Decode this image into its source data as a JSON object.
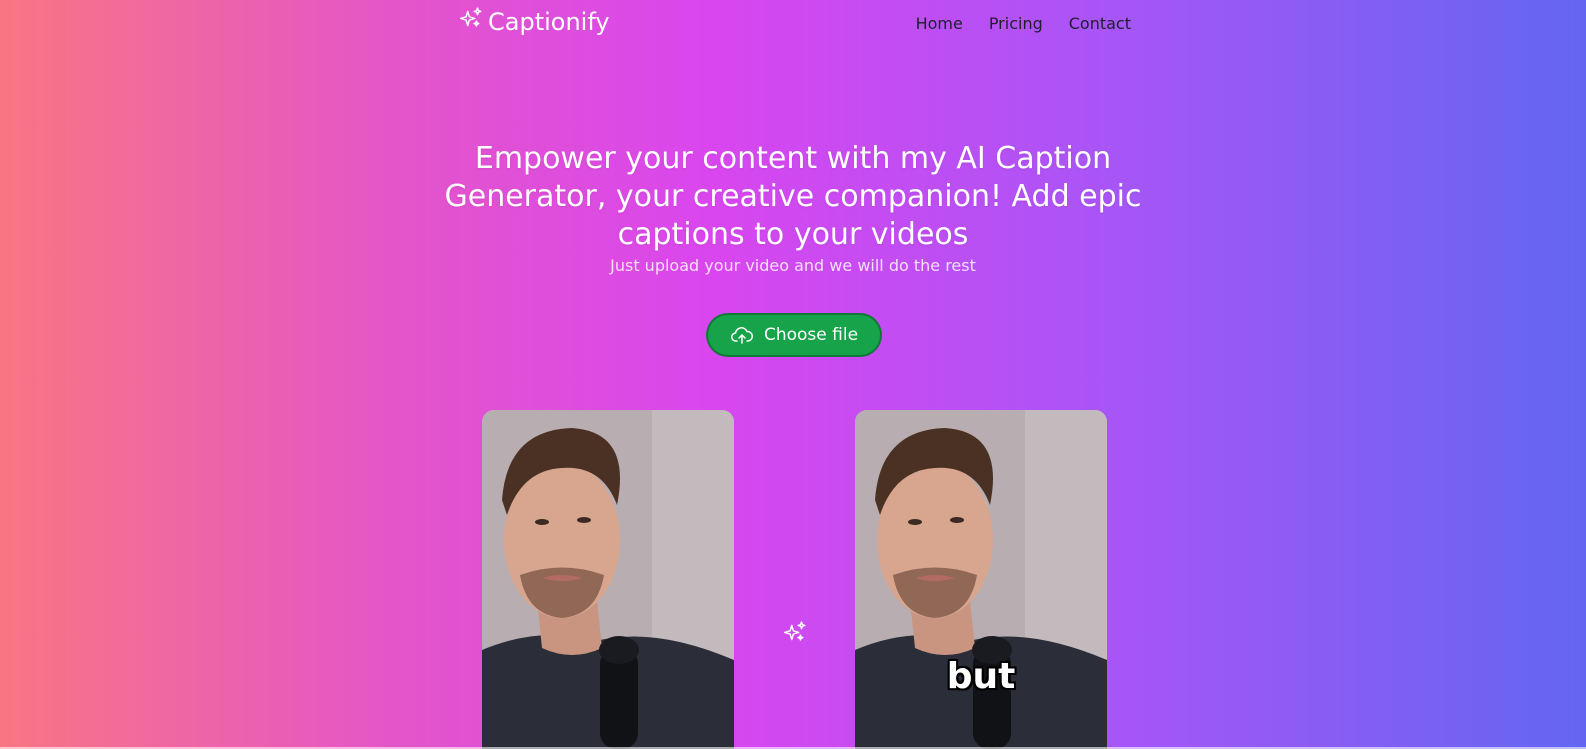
{
  "header": {
    "logo_text": "Captionify",
    "logo_icon": "sparkles-icon",
    "nav": [
      {
        "label": "Home"
      },
      {
        "label": "Pricing"
      },
      {
        "label": "Contact"
      }
    ]
  },
  "hero": {
    "headline": "Empower your content with my AI Caption Generator, your creative companion! Add epic captions to your videos",
    "subline": "Just upload your video and we will do the rest"
  },
  "upload": {
    "label": "Choose file",
    "icon": "cloud-upload-icon"
  },
  "demo": {
    "before_caption": "",
    "after_caption": "but",
    "transform_icon": "sparkles-icon"
  },
  "colors": {
    "gradient_start": "#f97583",
    "gradient_mid": "#d946ef",
    "gradient_end": "#6366f1",
    "button": "#16a34a"
  }
}
